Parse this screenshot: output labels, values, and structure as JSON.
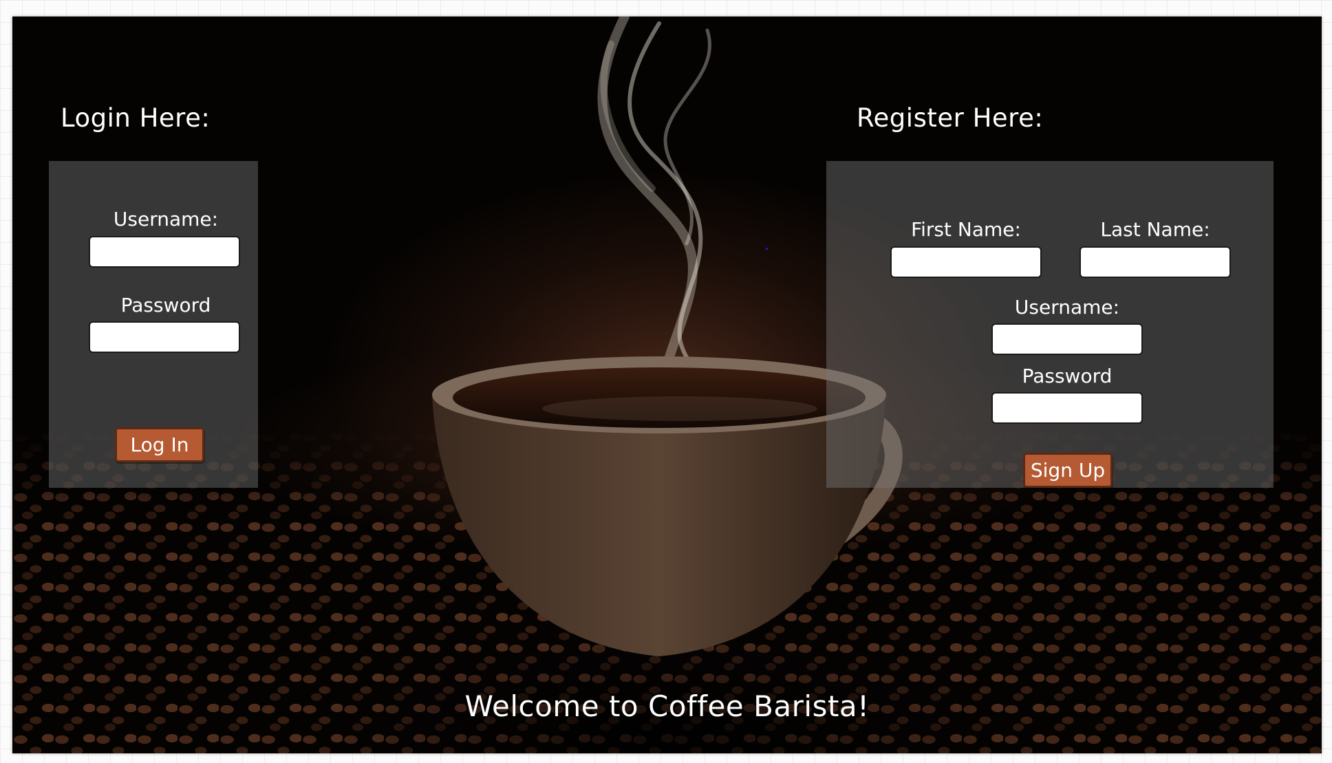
{
  "login": {
    "heading": "Login Here:",
    "username_label": "Username:",
    "username_value": "",
    "password_label": "Password",
    "password_value": "",
    "button_label": "Log In"
  },
  "register": {
    "heading": "Register Here:",
    "first_name_label": "First Name:",
    "first_name_value": "",
    "last_name_label": "Last Name:",
    "last_name_value": "",
    "username_label": "Username:",
    "username_value": "",
    "password_label": "Password",
    "password_value": "",
    "button_label": "Sign Up"
  },
  "footer": {
    "welcome": "Welcome to Coffee Barista!"
  },
  "colors": {
    "button_fill": "#b55a32",
    "button_border": "#5b2a14",
    "panel": "rgba(120,120,120,0.45)",
    "text": "#ffffff"
  }
}
